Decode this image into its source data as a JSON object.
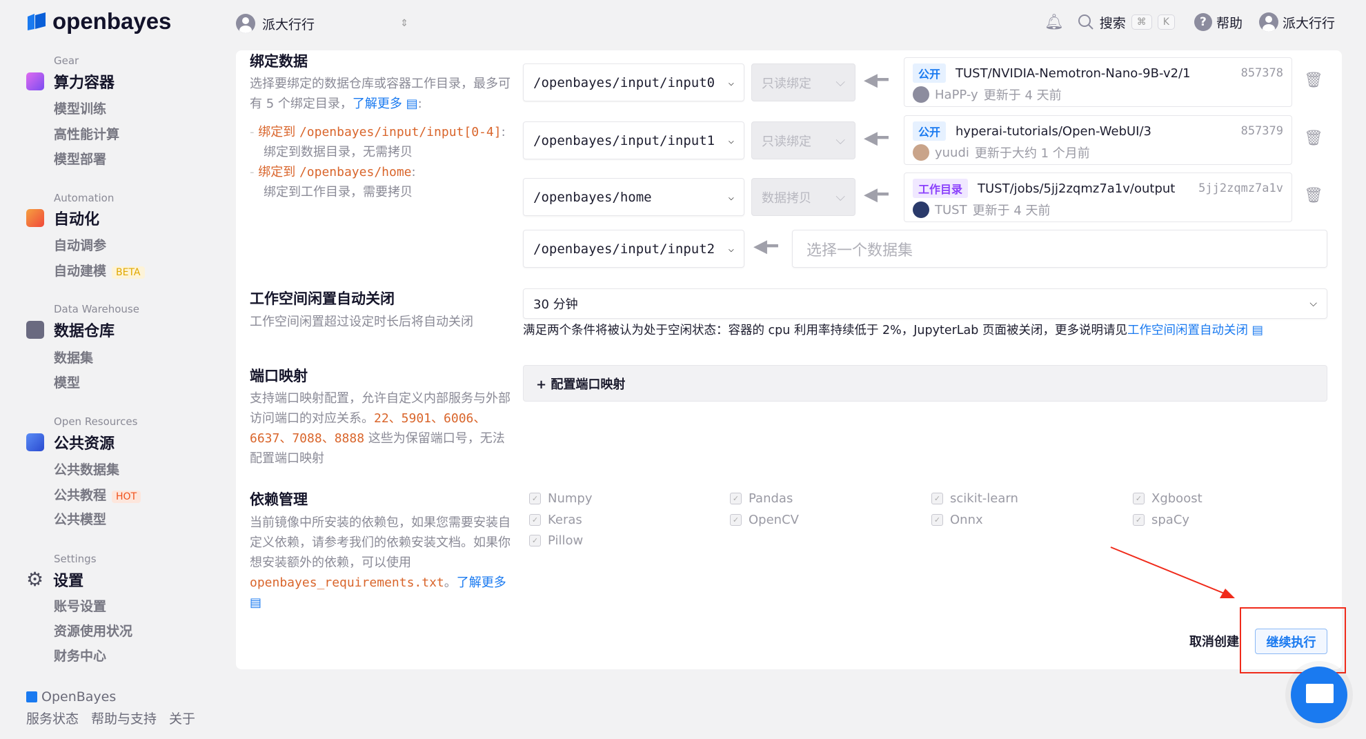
{
  "header": {
    "logo": "openbayes",
    "workspace": "派大行行",
    "search": "搜索",
    "kbd_cmd": "⌘",
    "kbd_k": "K",
    "help": "帮助",
    "user": "派大行行"
  },
  "sidebar": {
    "groups": [
      {
        "label": "Gear",
        "title": "算力容器",
        "color": "#a15cf0",
        "items": [
          "模型训练",
          "高性能计算",
          "模型部署"
        ]
      },
      {
        "label": "Automation",
        "title": "自动化",
        "color": "#f2683a",
        "items": [
          "自动调参",
          "自动建模"
        ]
      },
      {
        "label": "Data Warehouse",
        "title": "数据仓库",
        "color": "#6a6a80",
        "items": [
          "数据集",
          "模型"
        ]
      },
      {
        "label": "Open Resources",
        "title": "公共资源",
        "color": "#3d6cf0",
        "items": [
          "公共数据集",
          "公共教程",
          "公共模型"
        ]
      },
      {
        "label": "Settings",
        "title": "设置",
        "color": "#4a4a5a",
        "items": [
          "账号设置",
          "资源使用状况",
          "财务中心"
        ]
      }
    ],
    "beta": "BETA",
    "hot": "HOT",
    "footer": {
      "brand": "OpenBayes",
      "links": [
        "服务状态",
        "帮助与支持",
        "关于"
      ]
    }
  },
  "bind": {
    "title": "绑定数据",
    "desc": "选择要绑定的数据仓库或容器工作目录，最多可有 5 个绑定目录，",
    "learn": "了解更多",
    "b1_prefix": "绑定到 ",
    "b1_path": "/openbayes/input/input[0-4]",
    "b1_desc": "绑定到数据目录，无需拷贝",
    "b2_prefix": "绑定到 ",
    "b2_path": "/openbayes/home",
    "b2_desc": "绑定到工作目录，需要拷贝",
    "rows": [
      {
        "path": "/openbayes/input/input0",
        "mode": "只读绑定",
        "tag": "公开",
        "name": "TUST/NVIDIA-Nemotron-Nano-9B-v2/1",
        "id": "857378",
        "user": "HaPP-y",
        "updated": "更新于 4 天前"
      },
      {
        "path": "/openbayes/input/input1",
        "mode": "只读绑定",
        "tag": "公开",
        "name": "hyperai-tutorials/Open-WebUI/3",
        "id": "857379",
        "user": "yuudi",
        "updated": "更新于大约 1 个月前"
      },
      {
        "path": "/openbayes/home",
        "mode": "数据拷贝",
        "tag": "工作目录",
        "name": "TUST/jobs/5jj2zqmz7a1v/output",
        "id": "5jj2zqmz7a1v",
        "user": "TUST",
        "updated": "更新于 4 天前"
      }
    ],
    "empty_path": "/openbayes/input/input2",
    "empty_placeholder": "选择一个数据集"
  },
  "idle": {
    "title": "工作空间闲置自动关闭",
    "desc": "工作空间闲置超过设定时长后将自动关闭",
    "value": "30 分钟",
    "note": "满足两个条件将被认为处于空闲状态：容器的 cpu 利用率持续低于 2%，JupyterLab 页面被关闭，更多说明请见",
    "note_link": "工作空间闲置自动关闭"
  },
  "port": {
    "title": "端口映射",
    "desc1": "支持端口映射配置，允许自定义内部服务与外部访问端口的对应关系。",
    "ports": "22、5901、6006、6637、7088、8888",
    "desc2": " 这些为保留端口号，无法配置端口映射",
    "button": "+ 配置端口映射"
  },
  "deps": {
    "title": "依赖管理",
    "desc": "当前镜像中所安装的依赖包，如果您需要安装自定义依赖，请参考我们的依赖安装文档。如果你想安装额外的依赖，可以使用",
    "file": "openbayes_requirements.txt",
    "sep": "。",
    "learn": "了解更多",
    "packages": [
      "Numpy",
      "Pandas",
      "scikit-learn",
      "Xgboost",
      "Keras",
      "OpenCV",
      "Onnx",
      "spaCy",
      "Pillow"
    ]
  },
  "actions": {
    "cancel": "取消创建",
    "continue": "继续执行"
  }
}
